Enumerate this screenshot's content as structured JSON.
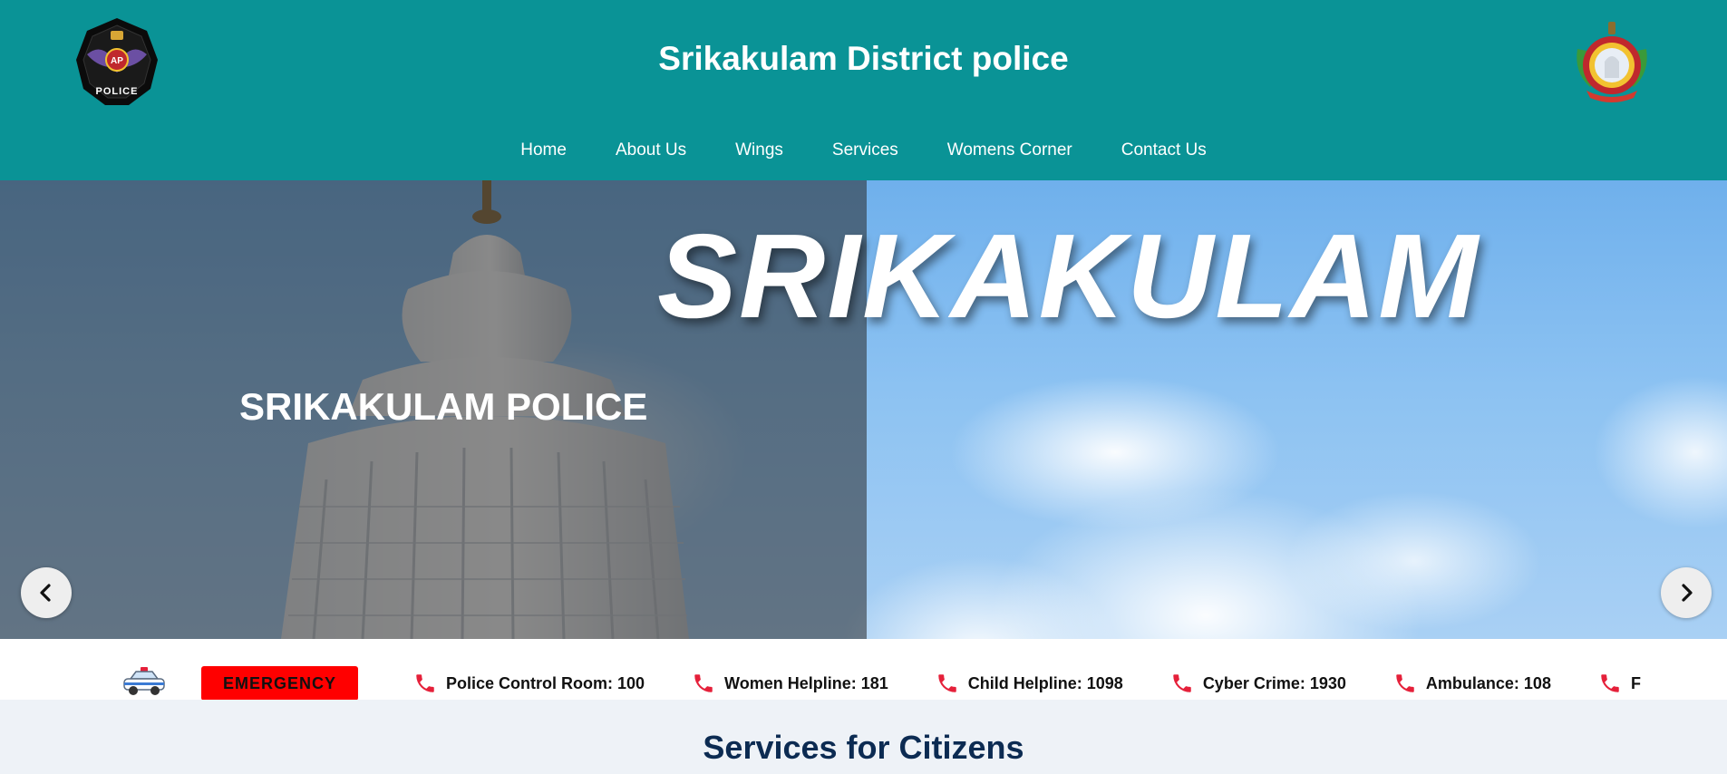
{
  "header": {
    "title": "Srikakulam District police",
    "left_logo_text": "POLICE",
    "left_logo_badge": "AP"
  },
  "nav": {
    "items": [
      {
        "label": "Home"
      },
      {
        "label": "About Us"
      },
      {
        "label": "Wings"
      },
      {
        "label": "Services"
      },
      {
        "label": "Womens Corner"
      },
      {
        "label": "Contact Us"
      }
    ]
  },
  "hero": {
    "banner_word": "SRIKAKULAM",
    "caption": "SRIKAKULAM POLICE"
  },
  "ticker": {
    "emergency_label": "EMERGENCY",
    "helplines": [
      {
        "label": "Police Control Room: 100"
      },
      {
        "label": "Women Helpline: 181"
      },
      {
        "label": "Child Helpline: 1098"
      },
      {
        "label": "Cyber Crime: 1930"
      },
      {
        "label": "Ambulance: 108"
      },
      {
        "label": "F"
      }
    ]
  },
  "services": {
    "title": "Services for Citizens"
  },
  "colors": {
    "header_bg": "#0a9396",
    "emergency_bg": "#ff0000",
    "phone_icon": "#e5203a",
    "services_title": "#0c2b52"
  },
  "icons": {
    "prev": "chevron-left-icon",
    "next": "chevron-right-icon",
    "helpline": "phone-icon",
    "vehicle": "police-car-icon"
  }
}
